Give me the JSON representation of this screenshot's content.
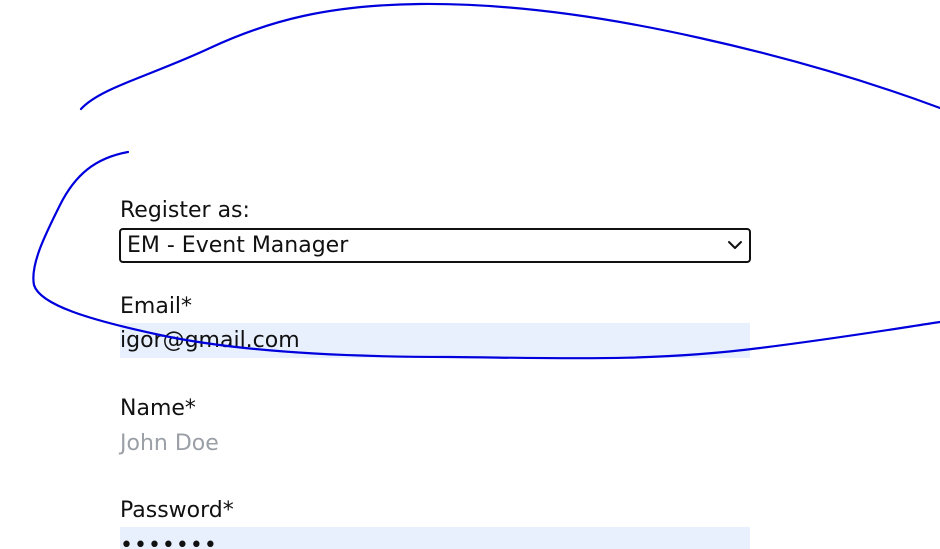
{
  "form": {
    "register_as": {
      "label": "Register as:",
      "selected": "EM - Event Manager"
    },
    "email": {
      "label": "Email*",
      "value": "igor@gmail.com"
    },
    "name": {
      "label": "Name*",
      "placeholder": "John Doe"
    },
    "password": {
      "label": "Password*",
      "masked_value": "•••••••"
    }
  },
  "colors": {
    "autofill_background": "#e8f0fe",
    "annotation_stroke": "#0000dd",
    "placeholder_text": "#9aa0a6"
  }
}
